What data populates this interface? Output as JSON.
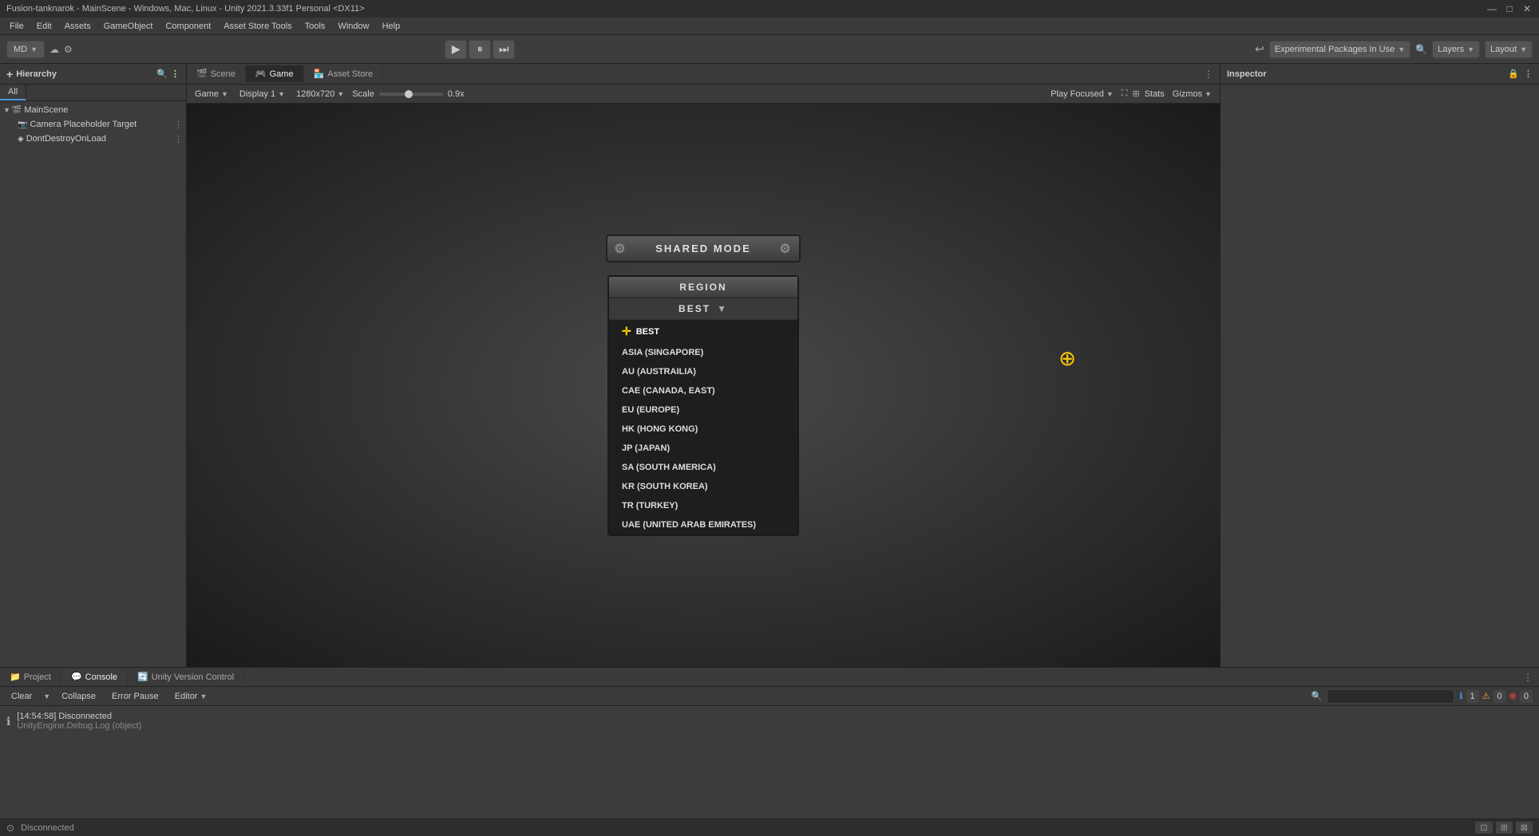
{
  "title_bar": {
    "text": "Fusion-tanknarok - MainScene - Windows, Mac, Linux - Unity 2021.3.33f1 Personal <DX11>",
    "minimize": "—",
    "maximize": "□",
    "close": "✕"
  },
  "menu_bar": {
    "items": [
      "File",
      "Edit",
      "Assets",
      "GameObject",
      "Component",
      "Asset Store Tools",
      "Tools",
      "Window",
      "Help"
    ]
  },
  "toolbar": {
    "profile_btn": "MD",
    "cloud_icon": "☁",
    "settings_icon": "⚙",
    "undo_icon": "↩",
    "play": "▶",
    "pause": "⏸",
    "step": "⏭",
    "packages_label": "Experimental Packages In Use",
    "search_icon": "🔍",
    "layers_label": "Layers",
    "layout_label": "Layout"
  },
  "hierarchy": {
    "panel_title": "Hierarchy",
    "tabs": [
      "All"
    ],
    "items": [
      {
        "label": "MainScene",
        "indent": 0,
        "expanded": true,
        "selected": false
      },
      {
        "label": "Camera Placeholder Target",
        "indent": 1,
        "expanded": false,
        "selected": false
      },
      {
        "label": "DontDestroyOnLoad",
        "indent": 1,
        "expanded": false,
        "selected": false
      }
    ]
  },
  "view_tabs": [
    {
      "label": "Scene",
      "icon": "🎬",
      "active": false
    },
    {
      "label": "Game",
      "icon": "🎮",
      "active": true
    },
    {
      "label": "Asset Store",
      "icon": "🏪",
      "active": false
    }
  ],
  "game_toolbar": {
    "display_label": "Display 1",
    "resolution": "1280x720",
    "scale_label": "Scale",
    "scale_value": "0.9x",
    "play_focused_label": "Play Focused",
    "stats_label": "Stats",
    "gizmos_label": "Gizmos"
  },
  "game_ui": {
    "shared_mode_label": "SHARED MODE",
    "region_label": "REGION",
    "region_selected": "BEST",
    "region_items": [
      {
        "label": "BEST",
        "icon": "crosshair"
      },
      {
        "label": "ASIA (SINGAPORE)",
        "icon": ""
      },
      {
        "label": "AU (AUSTRAILIA)",
        "icon": ""
      },
      {
        "label": "CAE (CANADA, EAST)",
        "icon": ""
      },
      {
        "label": "EU (EUROPE)",
        "icon": ""
      },
      {
        "label": "HK (HONG KONG)",
        "icon": ""
      },
      {
        "label": "JP (JAPAN)",
        "icon": ""
      },
      {
        "label": "SA (SOUTH AMERICA)",
        "icon": ""
      },
      {
        "label": "KR (SOUTH KOREA)",
        "icon": ""
      },
      {
        "label": "TR (TURKEY)",
        "icon": ""
      },
      {
        "label": "UAE (UNITED ARAB EMIRATES)",
        "icon": ""
      }
    ]
  },
  "inspector": {
    "panel_title": "Inspector",
    "lock_icon": "🔒",
    "more_icon": "⋮"
  },
  "bottom_panel": {
    "tabs": [
      {
        "label": "Project",
        "icon": "📁",
        "active": false
      },
      {
        "label": "Console",
        "icon": "💬",
        "active": true
      },
      {
        "label": "Unity Version Control",
        "icon": "🔄",
        "active": false
      }
    ],
    "console_toolbar": {
      "clear_label": "Clear",
      "collapse_label": "Collapse",
      "error_pause_label": "Error Pause",
      "editor_label": "Editor"
    },
    "counts": {
      "info": "1",
      "warning": "0",
      "error": "0"
    },
    "log_items": [
      {
        "time": "[14:54:58]",
        "level": "Disconnected",
        "message": "UnityEngine.Debug.Log (object)"
      }
    ]
  },
  "status_bar": {
    "status": "Disconnected",
    "icon": "⊙"
  }
}
